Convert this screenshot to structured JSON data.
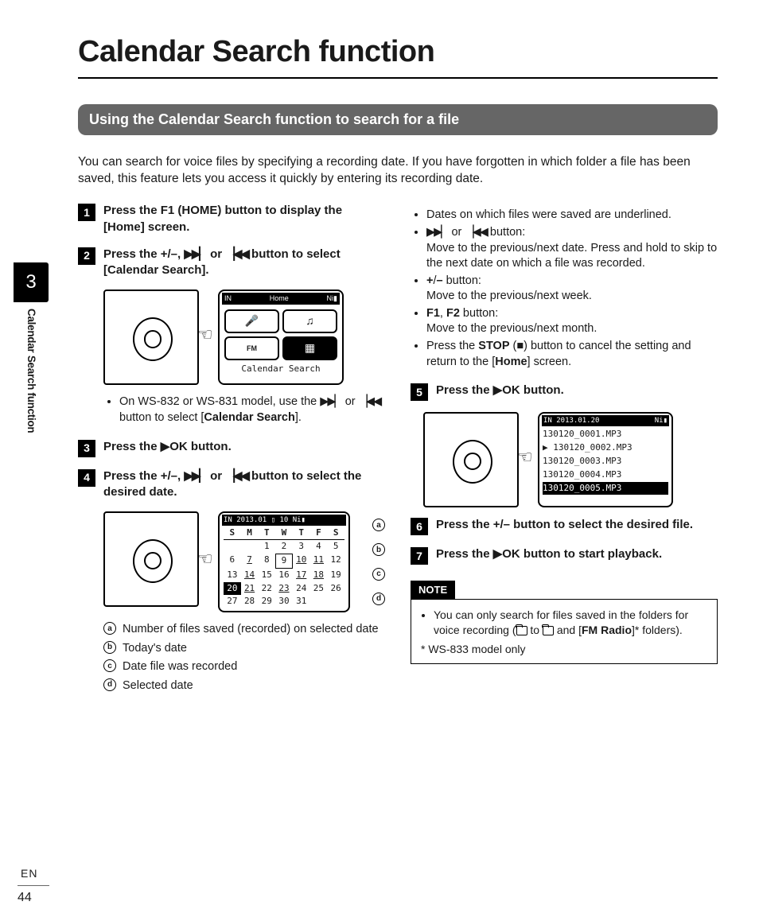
{
  "chapter": "3",
  "side_label": "Calendar Search function",
  "lang": "EN",
  "page": "44",
  "title": "Calendar Search function",
  "section_bar": "Using the Calendar Search function to search for a file",
  "intro": "You can search for voice files by specifying a recording date. If you have forgotten in which folder a file has been saved, this feature lets you access it quickly by entering its recording date.",
  "steps": {
    "s1_a": "Press the ",
    "s1_b": "F1 (HOME)",
    "s1_c": " button to display the [",
    "s1_d": "Home",
    "s1_e": "] screen.",
    "s2_a": "Press the ",
    "s2_b": "+/–, ",
    "s2_c": " or ",
    "s2_d": " button to select [",
    "s2_e": "Calendar Search",
    "s2_f": "].",
    "s3_a": "Press the ",
    "s3_b": "OK",
    "s3_c": " button.",
    "s4_a": "Press the ",
    "s4_b": "+/–, ",
    "s4_c": " or ",
    "s4_d": " button to select the desired date.",
    "s5_a": "Press the ",
    "s5_b": "OK",
    "s5_c": " button.",
    "s6": "Press the +/– button to select the desired file.",
    "s7_a": "Press the ",
    "s7_b": "OK",
    "s7_c": " button to start playback."
  },
  "screen_home": {
    "header_left": "IN",
    "header_center": "Home",
    "header_right": "Ni▮",
    "caption": "Calendar Search"
  },
  "sub_note_832": {
    "a": "On WS-832 or WS-831 model, use the ",
    "b": " or ",
    "c": " button to select [",
    "d": "Calendar Search",
    "e": "]."
  },
  "calendar": {
    "header": "IN 2013.01 ▯ 10 Ni▮",
    "days": [
      "S",
      "M",
      "T",
      "W",
      "T",
      "F",
      "S"
    ],
    "rows": [
      [
        "",
        "",
        "1",
        "2",
        "3",
        "4",
        "5"
      ],
      [
        "6",
        "7",
        "8",
        "9",
        "10",
        "11",
        "12"
      ],
      [
        "13",
        "14",
        "15",
        "16",
        "17",
        "18",
        "19"
      ],
      [
        "20",
        "21",
        "22",
        "23",
        "24",
        "25",
        "26"
      ],
      [
        "27",
        "28",
        "29",
        "30",
        "31",
        "",
        ""
      ]
    ],
    "today": "9",
    "selected": "20",
    "underlined": [
      "7",
      "9",
      "10",
      "11",
      "14",
      "17",
      "18",
      "21",
      "23"
    ]
  },
  "legend": {
    "a": "Number of files saved (recorded) on selected date",
    "b": "Today's date",
    "c": "Date file was recorded",
    "d": "Selected date"
  },
  "right_bullets": {
    "b1": "Dates on which files were saved are underlined.",
    "b2_a": " or ",
    "b2_b": " button:",
    "b2_body": "Move to the previous/next date. Press and hold to skip to the next date on which a file was recorded.",
    "b3_a": "+",
    "b3_b": "/",
    "b3_c": "–",
    "b3_d": " button:",
    "b3_body": "Move to the previous/next week.",
    "b4_a": "F1",
    "b4_b": ", ",
    "b4_c": "F2",
    "b4_d": " button:",
    "b4_body": "Move to the previous/next month.",
    "b5_a": "Press the ",
    "b5_b": "STOP",
    "b5_c": " (",
    "b5_d": ") button to cancel the setting and return to the [",
    "b5_e": "Home",
    "b5_f": "] screen."
  },
  "filelist": {
    "header_left": "IN 2013.01.20",
    "header_right": "Ni▮",
    "rows": [
      "130120_0001.MP3",
      "130120_0002.MP3",
      "130120_0003.MP3",
      "130120_0004.MP3",
      "130120_0005.MP3"
    ],
    "selected_index": 4
  },
  "note": {
    "label": "NOTE",
    "li_a": "You can only search for files saved in the folders for voice recording (",
    "li_b": " to ",
    "li_c": " and [",
    "li_d": "FM Radio",
    "li_e": "]* folders).",
    "foot": "* WS-833 model only"
  }
}
